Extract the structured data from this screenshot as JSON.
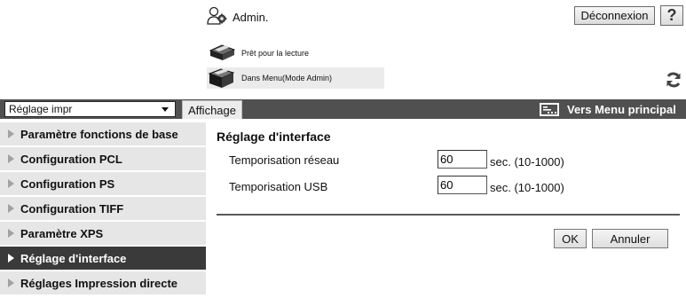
{
  "header": {
    "user_name": "Admin.",
    "logout_label": "Déconnexion",
    "help_label": "?",
    "status_ready": "Prêt pour la lecture",
    "status_mode": "Dans Menu(Mode Admin)"
  },
  "toolbar": {
    "menu_select_value": "Réglage impr",
    "display_tab": "Affichage",
    "to_main_menu": "Vers Menu principal"
  },
  "sidebar": {
    "items": [
      {
        "label": "Paramètre fonctions de base",
        "active": false
      },
      {
        "label": "Configuration PCL",
        "active": false
      },
      {
        "label": "Configuration PS",
        "active": false
      },
      {
        "label": "Configuration TIFF",
        "active": false
      },
      {
        "label": "Paramètre XPS",
        "active": false
      },
      {
        "label": "Réglage d'interface",
        "active": true
      },
      {
        "label": "Réglages Impression directe",
        "active": false
      }
    ]
  },
  "main": {
    "title": "Réglage d'interface",
    "fields": [
      {
        "label": "Temporisation réseau",
        "value": "60",
        "unit": "sec. (10-1000)"
      },
      {
        "label": "Temporisation USB",
        "value": "60",
        "unit": "sec. (10-1000)"
      }
    ],
    "ok_label": "OK",
    "cancel_label": "Annuler"
  },
  "icons": {
    "user": "admin-user-icon",
    "printer": "printer-icon",
    "refresh": "refresh-icon",
    "menu": "main-menu-icon",
    "arrow": "triangle-right-icon"
  }
}
